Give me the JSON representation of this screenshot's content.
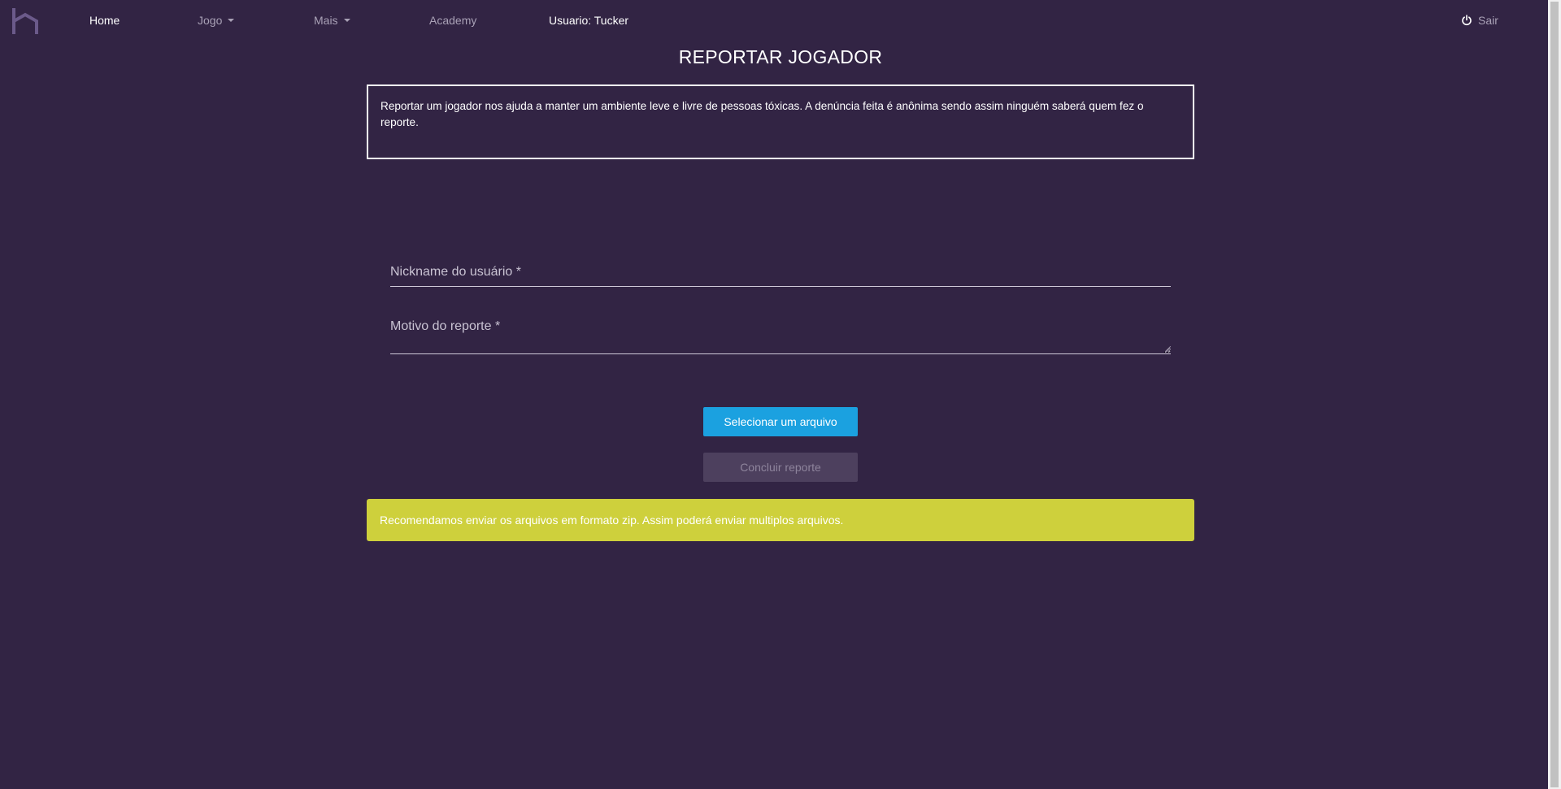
{
  "navbar": {
    "logo_icon": "hellow-logo-icon",
    "items": [
      {
        "label": "Home",
        "active": true
      },
      {
        "label": "Jogo",
        "dropdown": true
      },
      {
        "label": "Mais",
        "dropdown": true
      },
      {
        "label": "Academy"
      }
    ],
    "user_label": "Usuario: Tucker",
    "logout_label": "Sair",
    "logout_icon": "power-icon"
  },
  "page": {
    "title": "REPORTAR JOGADOR",
    "info_text": "Reportar um jogador nos ajuda a manter um ambiente leve e livre de pessoas tóxicas. A denúncia feita é anônima sendo assim ninguém saberá quem fez o reporte."
  },
  "form": {
    "nickname": {
      "label": "Nickname do usuário *",
      "value": ""
    },
    "reason": {
      "label": "Motivo do reporte *",
      "value": ""
    },
    "select_file_label": "Selecionar um arquivo",
    "submit_label": "Concluir reporte",
    "submit_disabled": true
  },
  "alert": {
    "text": "Recomendamos enviar os arquivos em formato zip. Assim poderá enviar multiplos arquivos.",
    "color": "#ced03c"
  },
  "colors": {
    "background": "#322444",
    "primary": "#1ba1e0",
    "disabled": "#4d405e"
  }
}
